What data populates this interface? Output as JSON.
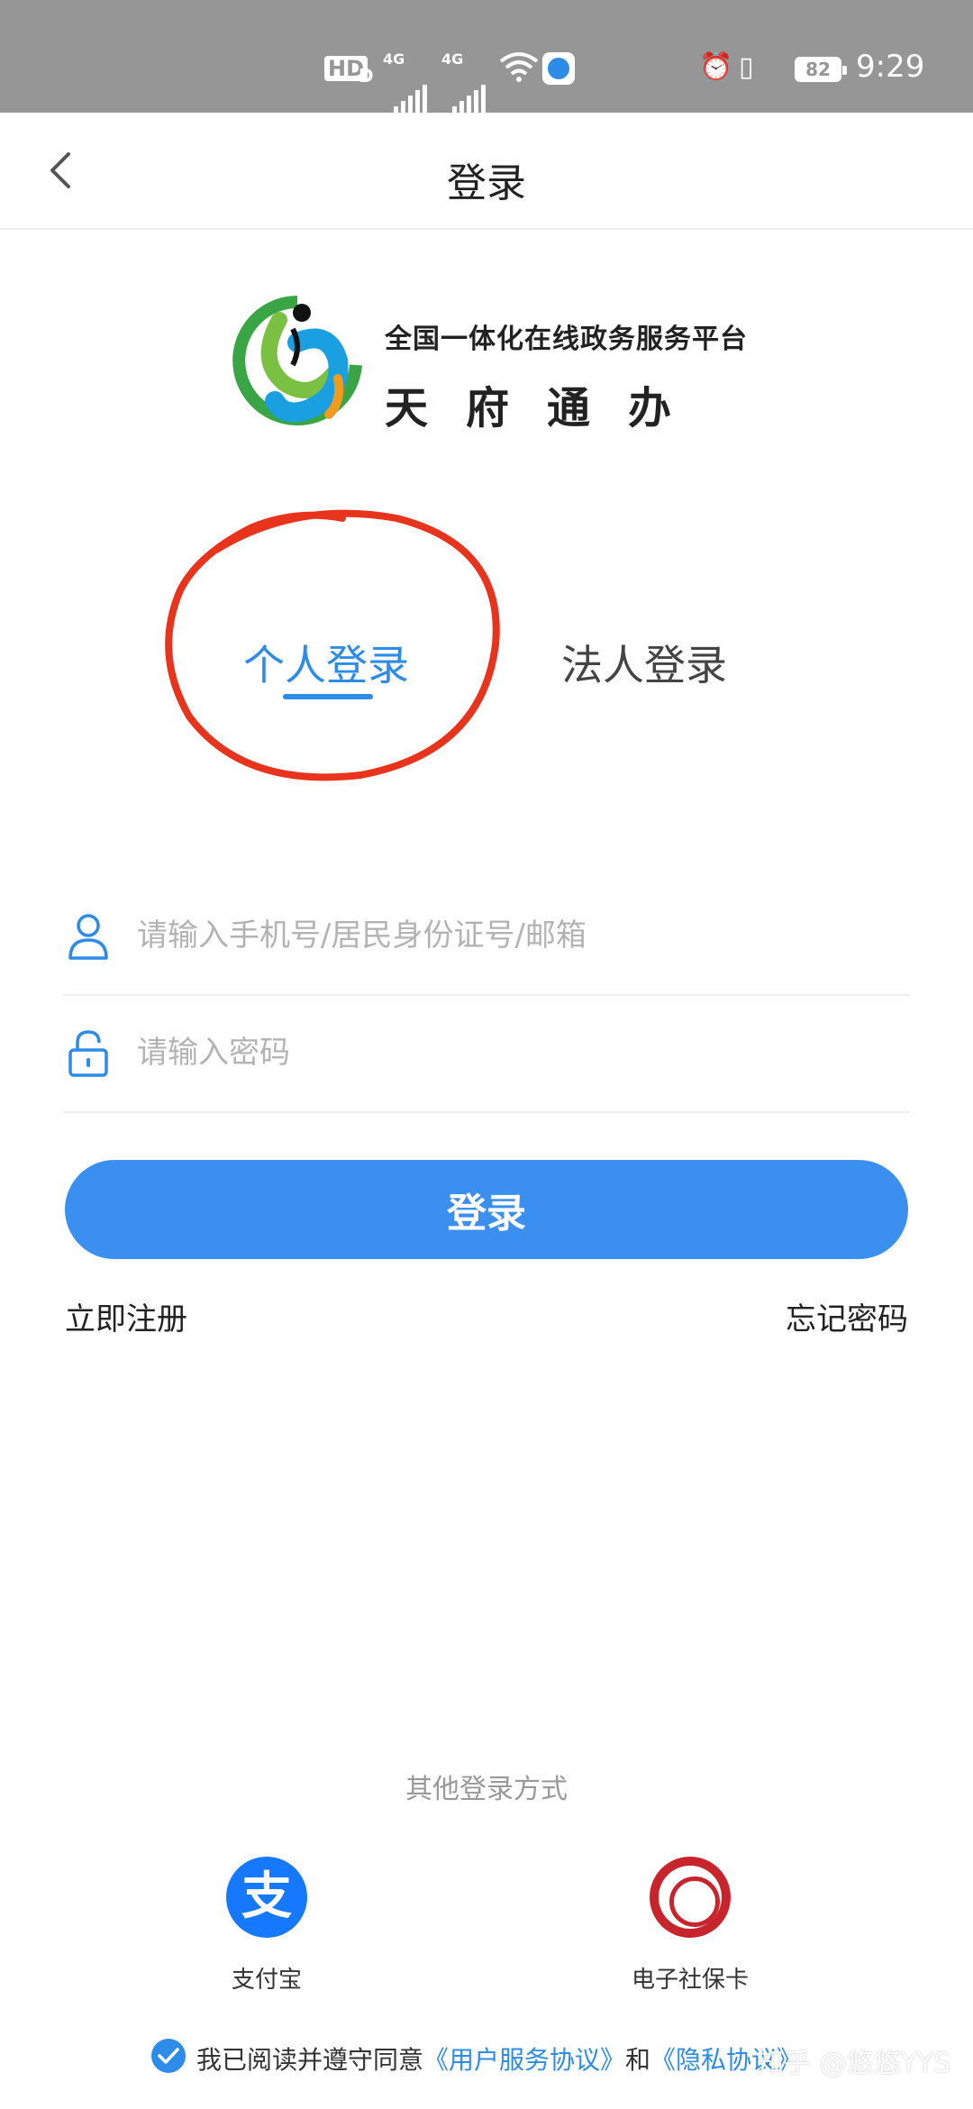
{
  "status_bar": {
    "hd_label": "HD",
    "hd_sub": "D",
    "signal_1_label": "4G",
    "signal_2_label": "4G",
    "battery_level": "82",
    "time": "9:29",
    "alarm_glyph": "⏰",
    "vibrate_glyph": "▯"
  },
  "header": {
    "back_icon": "chevron-left-icon",
    "title": "登录"
  },
  "logo": {
    "subtitle": "全国一体化在线政务服务平台",
    "name": "天府通办"
  },
  "tabs": [
    {
      "label": "个人登录",
      "active": true
    },
    {
      "label": "法人登录",
      "active": false
    }
  ],
  "form": {
    "account_placeholder": "请输入手机号/居民身份证号/邮箱",
    "account_value": "",
    "password_placeholder": "请输入密码",
    "password_value": "",
    "login_label": "登录",
    "register_label": "立即注册",
    "forgot_label": "忘记密码"
  },
  "other_login": {
    "title": "其他登录方式",
    "methods": [
      {
        "label": "支付宝",
        "glyph": "支",
        "icon": "alipay-icon"
      },
      {
        "label": "电子社保卡",
        "icon": "social-security-card-icon"
      }
    ]
  },
  "agreement": {
    "checked": true,
    "prefix": "我已阅读并遵守同意",
    "terms_link": "《用户服务协议》",
    "conjunction": "和",
    "privacy_link": "《隐私协议》"
  },
  "watermark": "知乎 @悠悠YYS",
  "colors": {
    "accent": "#2c8ce8",
    "button": "#3b8ff0",
    "annotation": "#e8341c",
    "status_bar": "#969696"
  }
}
